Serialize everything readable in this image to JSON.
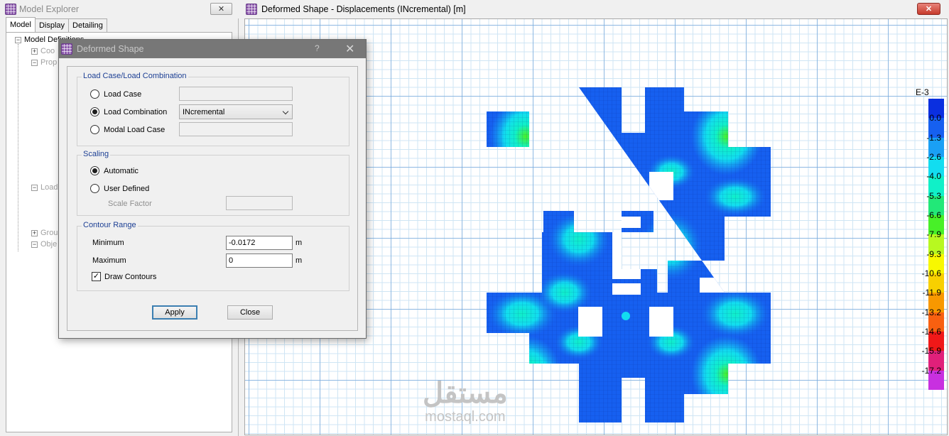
{
  "explorer": {
    "title": "Model Explorer",
    "close_label": "✕",
    "tabs": [
      {
        "label": "Model",
        "active": true
      },
      {
        "label": "Display",
        "active": false
      },
      {
        "label": "Detailing",
        "active": false
      }
    ],
    "tree_root": "Model Definitions",
    "tree_items": [
      "Coo",
      "Prop",
      "Load",
      "Grou",
      "Obje"
    ]
  },
  "view": {
    "title": "Deformed Shape - Displacements (INcremental)  [m]",
    "close_label": "✕",
    "legend": {
      "exponent": "E-3",
      "ticks": [
        "0.0",
        "-1.3",
        "-2.6",
        "-4.0",
        "-5.3",
        "-6.6",
        "-7.9",
        "-9.3",
        "-10.6",
        "-11.9",
        "-13.2",
        "-14.6",
        "-15.9",
        "-17.2"
      ],
      "colors": [
        "#0a2fe0",
        "#1660f0",
        "#1aa0f5",
        "#12ddf0",
        "#10f0c8",
        "#22e878",
        "#48f028",
        "#b8f820",
        "#f8f800",
        "#f8d000",
        "#f89800",
        "#f86010",
        "#f01818",
        "#e0207a",
        "#c830e0"
      ]
    },
    "watermark_arabic": "مستقل",
    "watermark_latin": "mostaql.com"
  },
  "dialog": {
    "title": "Deformed Shape",
    "help": "?",
    "close": "✕",
    "load_group_title": "Load Case/Load Combination",
    "load_case_label": "Load Case",
    "load_combination_label": "Load Combination",
    "load_combination_value": "INcremental",
    "modal_load_case_label": "Modal Load Case",
    "selected_load_option": "load_combination",
    "scaling_title": "Scaling",
    "automatic_label": "Automatic",
    "user_defined_label": "User Defined",
    "scale_factor_label": "Scale Factor",
    "selected_scaling": "automatic",
    "contour_title": "Contour Range",
    "minimum_label": "Minimum",
    "minimum_value": "-0.0172",
    "minimum_unit": "m",
    "maximum_label": "Maximum",
    "maximum_value": "0",
    "maximum_unit": "m",
    "draw_contours_label": "Draw Contours",
    "draw_contours_checked": true,
    "apply_label": "Apply",
    "close_label": "Close"
  }
}
